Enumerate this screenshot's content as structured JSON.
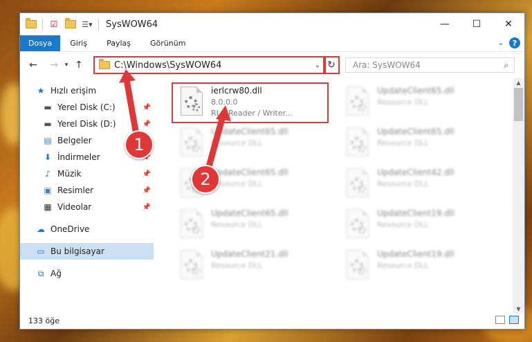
{
  "window": {
    "title": "SysWOW64"
  },
  "ribbon": {
    "tabs": [
      "Dosya",
      "Giriş",
      "Paylaş",
      "Görünüm"
    ],
    "active_tab": "Dosya",
    "help": "?"
  },
  "nav": {
    "address": "C:\\Windows\\SysWOW64",
    "search_placeholder": "Ara: SysWOW64"
  },
  "sidebar": {
    "items": [
      {
        "label": "Hızlı erişim",
        "icon": "star-icon",
        "pinned": false
      },
      {
        "label": "Yerel Disk (C:)",
        "icon": "drive-icon",
        "pinned": true
      },
      {
        "label": "Yerel Disk (D:)",
        "icon": "drive-icon",
        "pinned": true
      },
      {
        "label": "Belgeler",
        "icon": "documents-icon",
        "pinned": true
      },
      {
        "label": "İndirmeler",
        "icon": "download-icon",
        "pinned": true
      },
      {
        "label": "Müzik",
        "icon": "music-icon",
        "pinned": true
      },
      {
        "label": "Resimler",
        "icon": "pictures-icon",
        "pinned": true
      },
      {
        "label": "Videolar",
        "icon": "videos-icon",
        "pinned": true
      },
      {
        "label": "OneDrive",
        "icon": "cloud-icon",
        "pinned": false
      },
      {
        "label": "Bu bilgisayar",
        "icon": "computer-icon",
        "pinned": false,
        "selected": true
      },
      {
        "label": "Ağ",
        "icon": "network-icon",
        "pinned": false
      }
    ]
  },
  "files": [
    {
      "name": "ierlcrw80.dll",
      "version": "8.0.0.0",
      "desc": "RLC Reader / Writer...",
      "highlighted": true
    },
    {
      "name": "UpdateClient65.dll",
      "desc": "Resource DLL"
    },
    {
      "name": "UpdateClient65.dll",
      "desc": "Resource DLL"
    },
    {
      "name": "UpdateClient65.dll",
      "desc": "Resource DLL"
    },
    {
      "name": "UpdateClient65.dll",
      "desc": "Resource DLL"
    },
    {
      "name": "UpdateClient42.dll",
      "desc": "Resource DLL"
    },
    {
      "name": "UpdateClient65.dll",
      "desc": "Resource DLL"
    },
    {
      "name": "UpdateClient19.dll",
      "desc": "Resource DLL"
    },
    {
      "name": "UpdateClient21.dll",
      "desc": "Resource DLL"
    },
    {
      "name": "UpdateClient19.dll",
      "desc": "Resource DLL"
    }
  ],
  "status": {
    "count": "133 öğe"
  },
  "annotations": {
    "badge1": "1",
    "badge2": "2",
    "color": "#e03838"
  }
}
